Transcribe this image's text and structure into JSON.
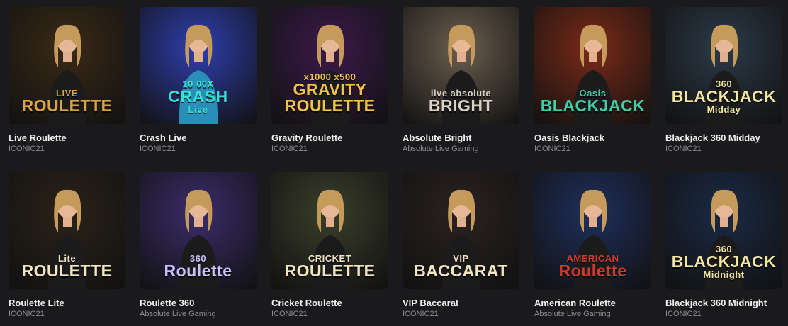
{
  "games": [
    {
      "title": "Live Roulette",
      "provider": "ICONIC21",
      "logo_small": "LIVE",
      "logo_big": "ROULETTE",
      "bg": "#3a2a16",
      "accent": "#d9a441"
    },
    {
      "title": "Crash Live",
      "provider": "ICONIC21",
      "logo_small": "10 00X",
      "logo_big": "CRASH",
      "logo_extra": "Live",
      "bg": "#2f3fb0",
      "accent": "#39e0d4"
    },
    {
      "title": "Gravity Roulette",
      "provider": "ICONIC21",
      "logo_small": "x1000  x500",
      "logo_big": "GRAVITY ROULETTE",
      "bg": "#3b1a4a",
      "accent": "#f0c24a"
    },
    {
      "title": "Absolute Bright",
      "provider": "Absolute Live Gaming",
      "logo_small": "live absolute",
      "logo_big": "BRIGHT",
      "bg": "#6b5e4e",
      "accent": "#d9d2c5"
    },
    {
      "title": "Oasis Blackjack",
      "provider": "ICONIC21",
      "logo_small": "Oasis",
      "logo_big": "BLACKJACK",
      "bg": "#7a2a18",
      "accent": "#3fcfa8"
    },
    {
      "title": "Blackjack 360 Midday",
      "provider": "ICONIC21",
      "logo_small": "360",
      "logo_big": "BLACKJACK",
      "logo_extra": "Midday",
      "bg": "#2b3a48",
      "accent": "#f3e6a0"
    },
    {
      "title": "Roulette Lite",
      "provider": "ICONIC21",
      "logo_small": "Lite",
      "logo_big": "ROULETTE",
      "bg": "#2a2218",
      "accent": "#f2e6c2"
    },
    {
      "title": "Roulette 360",
      "provider": "Absolute Live Gaming",
      "logo_small": "360",
      "logo_big": "Roulette",
      "bg": "#3b2d6b",
      "accent": "#c8c2ff"
    },
    {
      "title": "Cricket Roulette",
      "provider": "ICONIC21",
      "logo_small": "CRICKET",
      "logo_big": "ROULETTE",
      "bg": "#3a3f2a",
      "accent": "#f2e6c2"
    },
    {
      "title": "VIP Baccarat",
      "provider": "ICONIC21",
      "logo_small": "VIP",
      "logo_big": "BACCARAT",
      "bg": "#2a2220",
      "accent": "#f2e6c2"
    },
    {
      "title": "American Roulette",
      "provider": "Absolute Live Gaming",
      "logo_small": "AMERICAN",
      "logo_big": "Roulette",
      "bg": "#1f2f5c",
      "accent": "#d0392b"
    },
    {
      "title": "Blackjack 360 Midnight",
      "provider": "ICONIC21",
      "logo_small": "360",
      "logo_big": "BLACKJACK",
      "logo_extra": "Midnight",
      "bg": "#1a2a44",
      "accent": "#f3e6a0"
    }
  ]
}
